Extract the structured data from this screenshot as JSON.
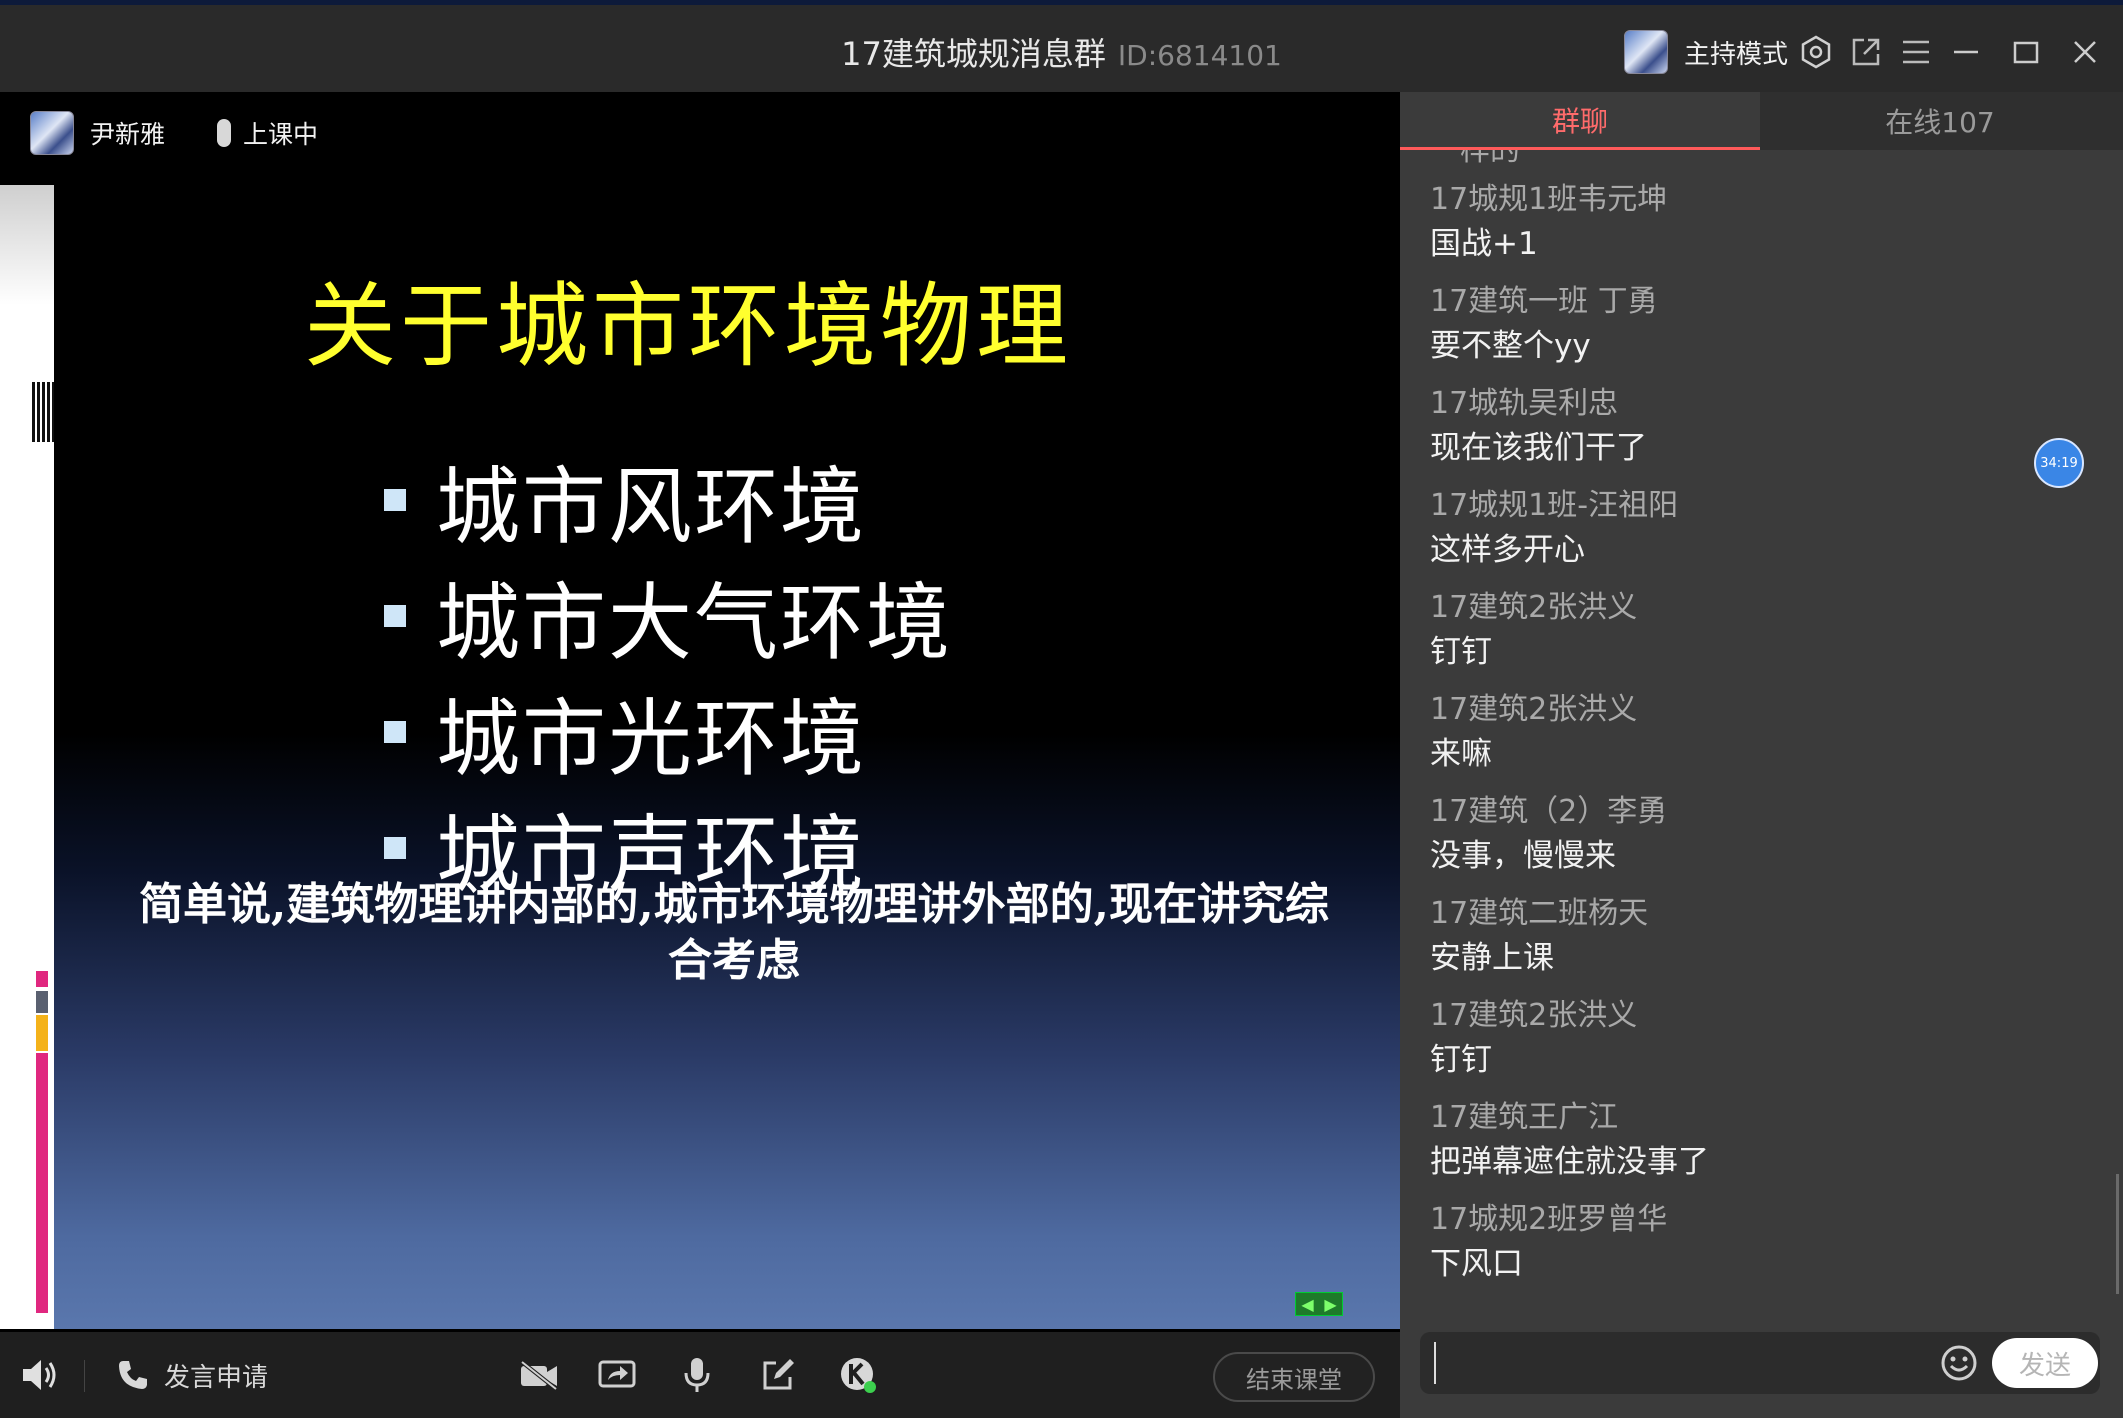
{
  "window": {
    "title": "17建筑城规消息群",
    "id_label": "ID:6814101",
    "host_mode": "主持模式"
  },
  "stage": {
    "presenter_name": "尹新雅",
    "status": "上课中"
  },
  "slide": {
    "title": "关于城市环境物理",
    "bullets": [
      "城市风环境",
      "城市大气环境",
      "城市光环境",
      "城市声环境"
    ],
    "note": "简单说,建筑物理讲内部的,城市环境物理讲外部的,现在讲究综合考虑"
  },
  "toolbar": {
    "speak_request": "发言申请",
    "end_class": "结束课堂"
  },
  "chat": {
    "tabs": {
      "group": "群聊",
      "online": "在线107"
    },
    "partial_top": "一样的",
    "messages": [
      {
        "sender": "17城规1班韦元坤",
        "content": "国战+1"
      },
      {
        "sender": "17建筑一班 丁勇",
        "content": "要不整个yy"
      },
      {
        "sender": "17城轨吴利忠",
        "content": "现在该我们干了"
      },
      {
        "sender": "17城规1班-汪祖阳",
        "content": "这样多开心"
      },
      {
        "sender": "17建筑2张洪义",
        "content": "钉钉"
      },
      {
        "sender": "17建筑2张洪义",
        "content": "来嘛"
      },
      {
        "sender": "17建筑（2）李勇",
        "content": "没事，慢慢来"
      },
      {
        "sender": "17建筑二班杨天",
        "content": "安静上课"
      },
      {
        "sender": "17建筑2张洪义",
        "content": "钉钉"
      },
      {
        "sender": "17建筑王广江",
        "content": "把弹幕遮住就没事了"
      },
      {
        "sender": "17城规2班罗曾华",
        "content": "下风口"
      }
    ],
    "timer": "34:19",
    "input_value": "",
    "send_label": "发送"
  },
  "icons": [
    "settings-icon",
    "popout-icon",
    "menu-icon",
    "minimize-icon",
    "maximize-icon",
    "close-icon",
    "speaker-icon",
    "phone-icon",
    "camera-off-icon",
    "screen-share-icon",
    "microphone-icon",
    "edit-icon",
    "k-app-icon",
    "emoji-icon"
  ]
}
